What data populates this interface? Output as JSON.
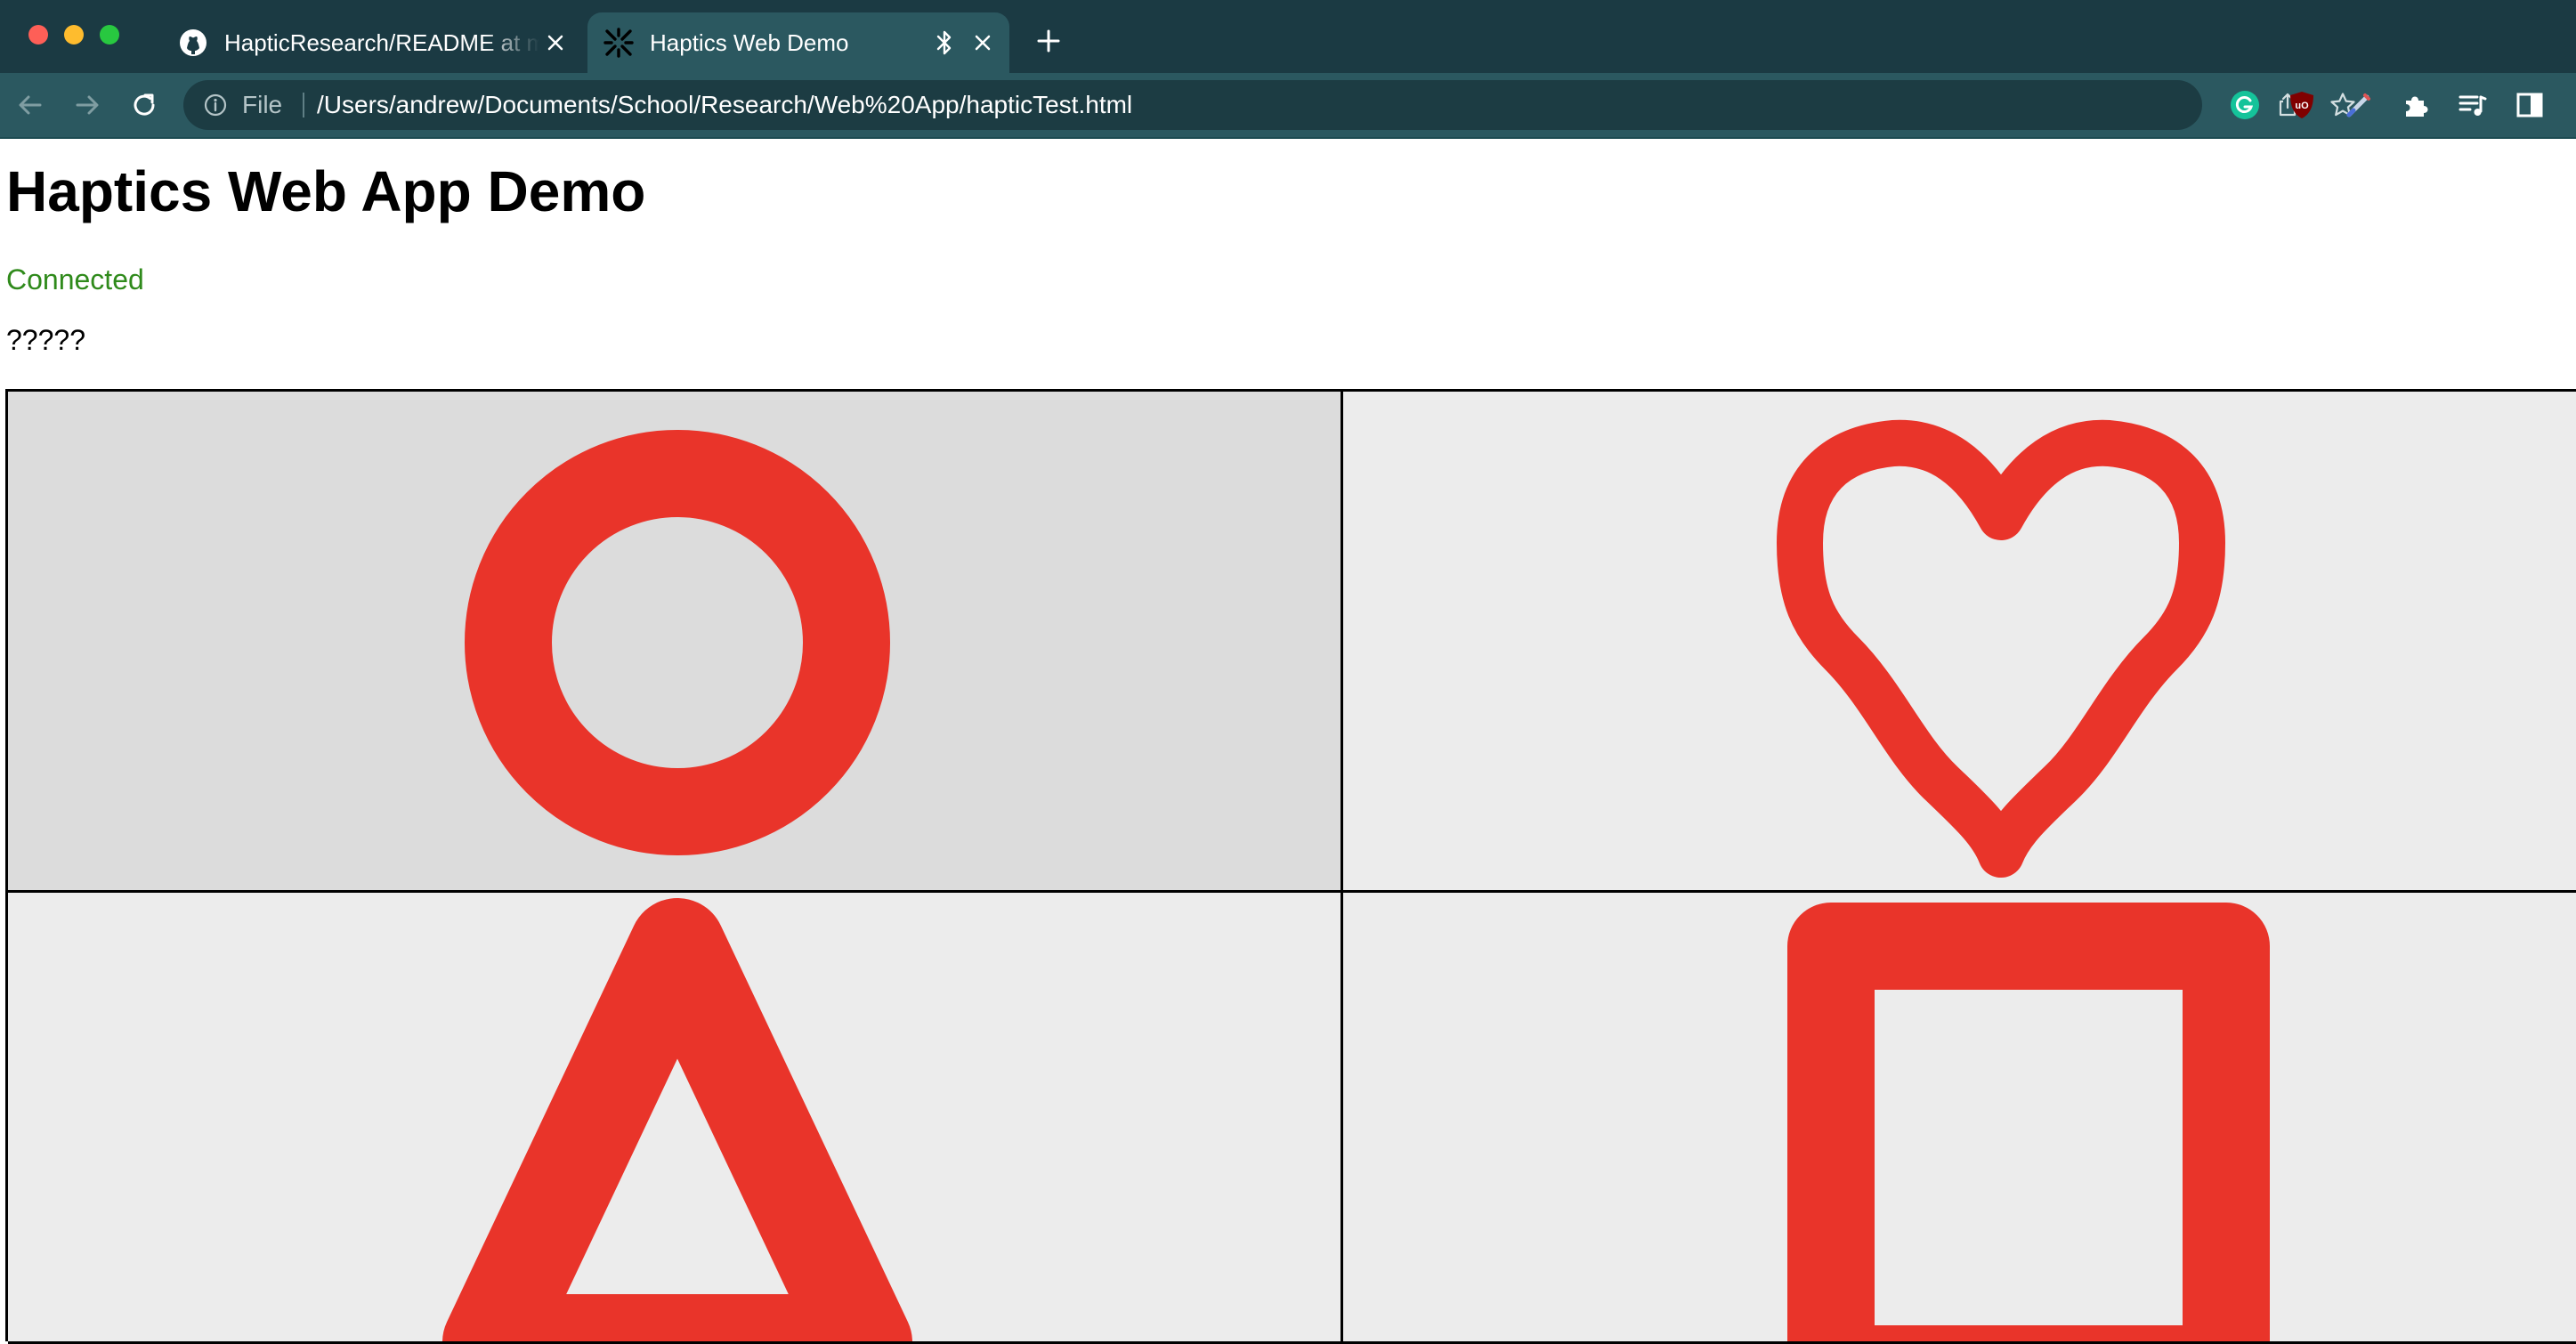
{
  "browser": {
    "tabs": [
      {
        "title": "HapticResearch/README at main",
        "icon": "github-icon",
        "active": false
      },
      {
        "title": "Haptics Web Demo",
        "icon": "app-favicon-icon",
        "active": true
      }
    ],
    "address": {
      "scheme_label": "File",
      "url": "/Users/andrew/Documents/School/Research/Web%20App/hapticTest.html"
    },
    "extensions": [
      "grammarly-icon",
      "ublock-icon",
      "pen-icon",
      "puzzle-icon",
      "playlist-icon",
      "side-panel-icon"
    ]
  },
  "page": {
    "title": "Haptics Web App Demo",
    "status": "Connected",
    "status_color": "#2f8a1b",
    "mystery_text": "?????"
  },
  "shapes": {
    "color": "#e9342a",
    "items": [
      {
        "name": "circle"
      },
      {
        "name": "heart"
      },
      {
        "name": "triangle"
      },
      {
        "name": "square"
      }
    ]
  }
}
